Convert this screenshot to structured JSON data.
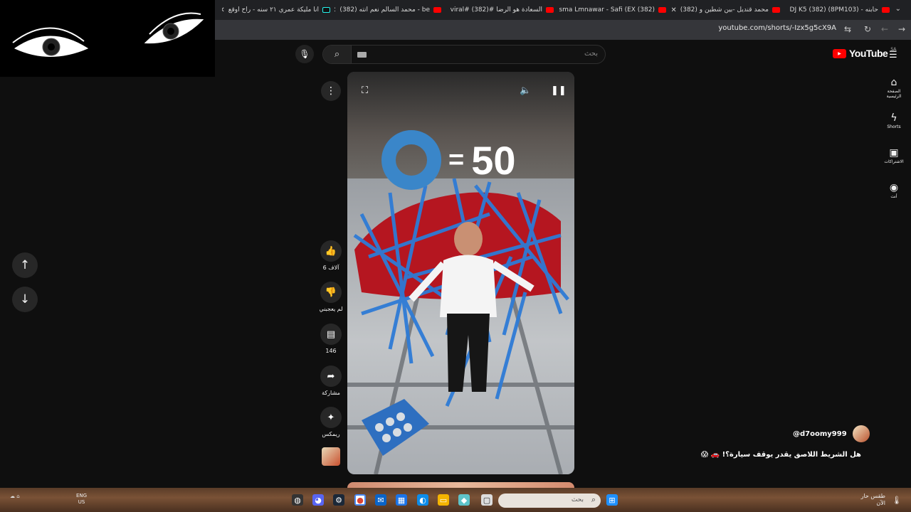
{
  "browser": {
    "tabs": [
      {
        "title": "انا مليكة عمري ٢١ سنه - راح اوقع",
        "favicon": "tiktok"
      },
      {
        "title": "be - محمد السالم نعم انته (382)",
        "favicon": "youtube"
      },
      {
        "title": "السعادة هو الرضا #viral# (382)",
        "favicon": "youtube"
      },
      {
        "title": "Asma Lmnawar - Safi (EX (382)",
        "favicon": "youtube"
      },
      {
        "title": "محمد قنديل -بين شطين و (382)",
        "favicon": "youtube"
      },
      {
        "title": "حابنه - (8PM103) DJ K5 (382)",
        "favicon": "youtube"
      }
    ],
    "url": "youtube.com/shorts/-Izx5g5cX9A"
  },
  "search": {
    "placeholder": "بحث"
  },
  "logo": {
    "word": "YouTube",
    "country": "SA"
  },
  "rail": {
    "items": [
      {
        "label": "الصفحة الرئيسية",
        "icon": "home-icon"
      },
      {
        "label": "Shorts",
        "icon": "shorts-icon"
      },
      {
        "label": "الاشتراكات",
        "icon": "subscriptions-icon"
      },
      {
        "label": "أنت",
        "icon": "account-icon"
      }
    ]
  },
  "video": {
    "overlay_count": "50",
    "overlay_equals": "="
  },
  "actions": {
    "like": "6 آلاف",
    "dislike": "لم يعجبني",
    "comments": "146",
    "share": "مشاركة",
    "remix": "ريمكس"
  },
  "channel": {
    "handle": "@d7oomy999",
    "caption": "هل الشريط اللاصق يقدر يوقف سيارة؟! 🚗 😱"
  },
  "taskbar": {
    "search_placeholder": "بحث",
    "weather": "طقس حار",
    "weather_sub": "الآن",
    "lang": "ENG",
    "region": "US"
  },
  "colors": {
    "accent": "#ff0000",
    "tape_blue": "#3a86c9",
    "background": "#0f0f0f"
  }
}
